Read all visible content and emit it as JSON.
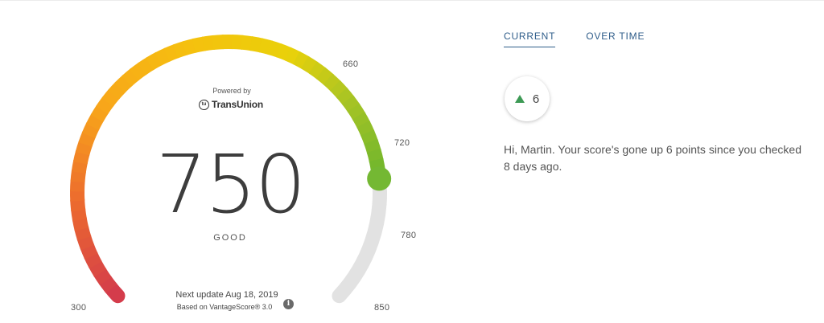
{
  "gauge": {
    "ticks": {
      "min": "300",
      "t660": "660",
      "t720": "720",
      "t780": "780",
      "max": "850"
    },
    "score_min": 300,
    "score_max": 850,
    "score_value": 750,
    "powered_by": "Powered by",
    "provider": "TransUnion",
    "provider_mark": "tu",
    "score": "750",
    "rating": "GOOD",
    "next_update": "Next update Aug 18, 2019",
    "based_on": "Based on VantageScore® 3.0",
    "info_icon": "i",
    "colors": {
      "low": "#d23a4a",
      "mid": "#f6b516",
      "high": "#6cb52d",
      "track": "#e2e2e2"
    }
  },
  "panel": {
    "tabs": [
      {
        "label": "CURRENT",
        "active": true
      },
      {
        "label": "OVER TIME",
        "active": false
      }
    ],
    "change": {
      "value": "6",
      "direction": "up",
      "icon": "up-triangle-icon"
    },
    "message": "Hi, Martin. Your score's gone up 6 points since you checked 8 days ago."
  }
}
